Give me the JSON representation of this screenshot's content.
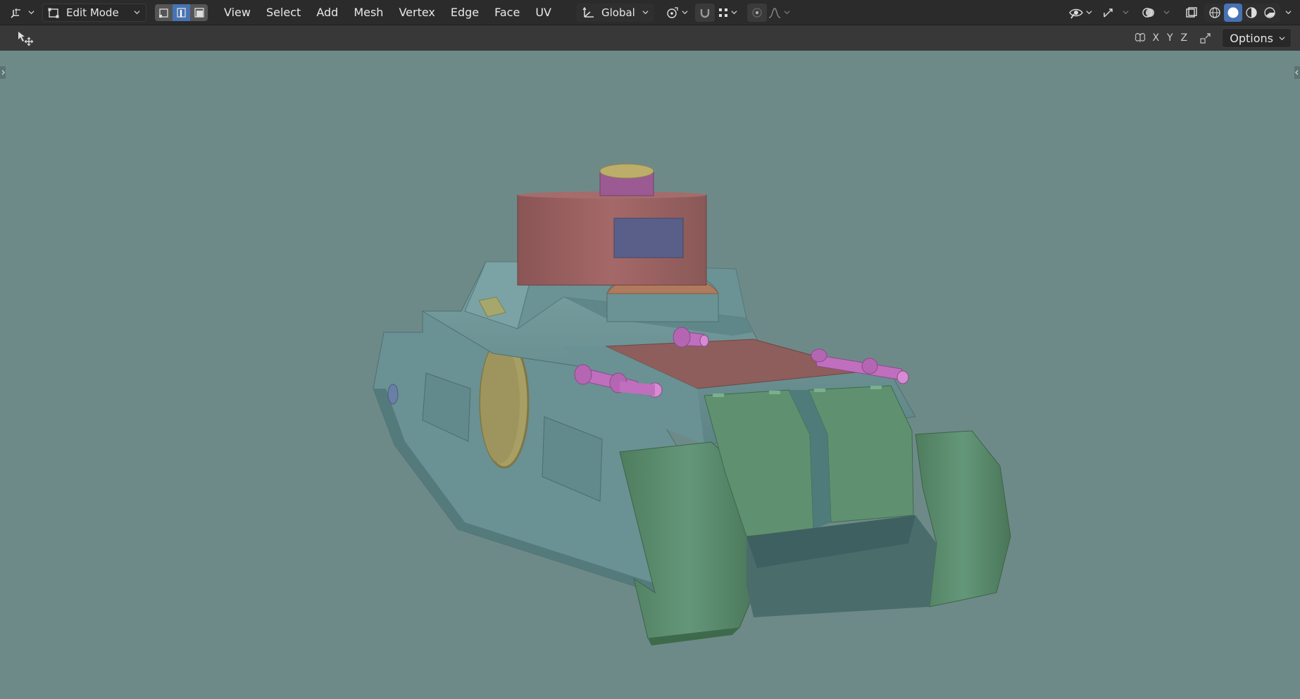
{
  "header": {
    "editor_type_icon": "editor-type-3d-viewport-icon",
    "mode": {
      "label": "Edit Mode",
      "icon": "edit-mode-icon"
    },
    "select_modes": [
      "vertex",
      "edge",
      "face"
    ],
    "active_select_mode": "edge",
    "menus": [
      "View",
      "Select",
      "Add",
      "Mesh",
      "Vertex",
      "Edge",
      "Face",
      "UV"
    ],
    "transform_orientation": {
      "label": "Global"
    },
    "shading": {
      "modes": [
        "wireframe",
        "solid",
        "material-preview",
        "rendered"
      ],
      "active": "solid"
    }
  },
  "tool_header": {
    "active_tool_icon": "transform-tool-icon",
    "mirror_axes": [
      "X",
      "Y",
      "Z"
    ],
    "options_label": "Options"
  },
  "colors": {
    "header_bg": "#2b2b2b",
    "tool_header_bg": "#383838",
    "viewport_bg": "#6e8a88",
    "accent": "#4772b3",
    "hull": "#6f9597",
    "tracks": "#5b8a6a",
    "turret": "#9a5e5e",
    "cannons": "#c06fbe",
    "hatch": "#a89f64",
    "window": "#5a5f8a"
  }
}
